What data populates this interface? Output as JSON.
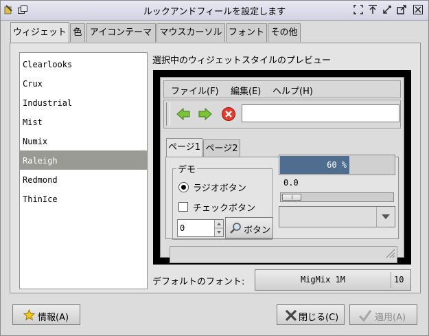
{
  "window": {
    "title": "ルックアンドフィールを設定します"
  },
  "tabs": [
    "ウィジェット",
    "色",
    "アイコンテーマ",
    "マウスカーソル",
    "フォント",
    "その他"
  ],
  "themes": [
    "Clearlooks",
    "Crux",
    "Industrial",
    "Mist",
    "Numix",
    "Raleigh",
    "Redmond",
    "ThinIce"
  ],
  "selected_theme": "Raleigh",
  "preview": {
    "label": "選択中のウィジェットスタイルのプレビュー",
    "menu": [
      "ファイル(F)",
      "編集(E)",
      "ヘルプ(H)"
    ],
    "page_tabs": [
      "ページ1",
      "ページ2"
    ],
    "demo_label": "デモ",
    "radio_label": "ラジオボタン",
    "check_label": "チェックボタン",
    "spin_value": "0",
    "button_label": "ボタン",
    "progress_text": "60 %",
    "progress_value": 0.6,
    "scale_value": "0.0"
  },
  "font": {
    "label": "デフォルトのフォント:",
    "name": "MigMix 1M",
    "size": "10"
  },
  "buttons": {
    "about": "情報(A)",
    "close": "閉じる(C)",
    "apply": "適用(A)"
  }
}
